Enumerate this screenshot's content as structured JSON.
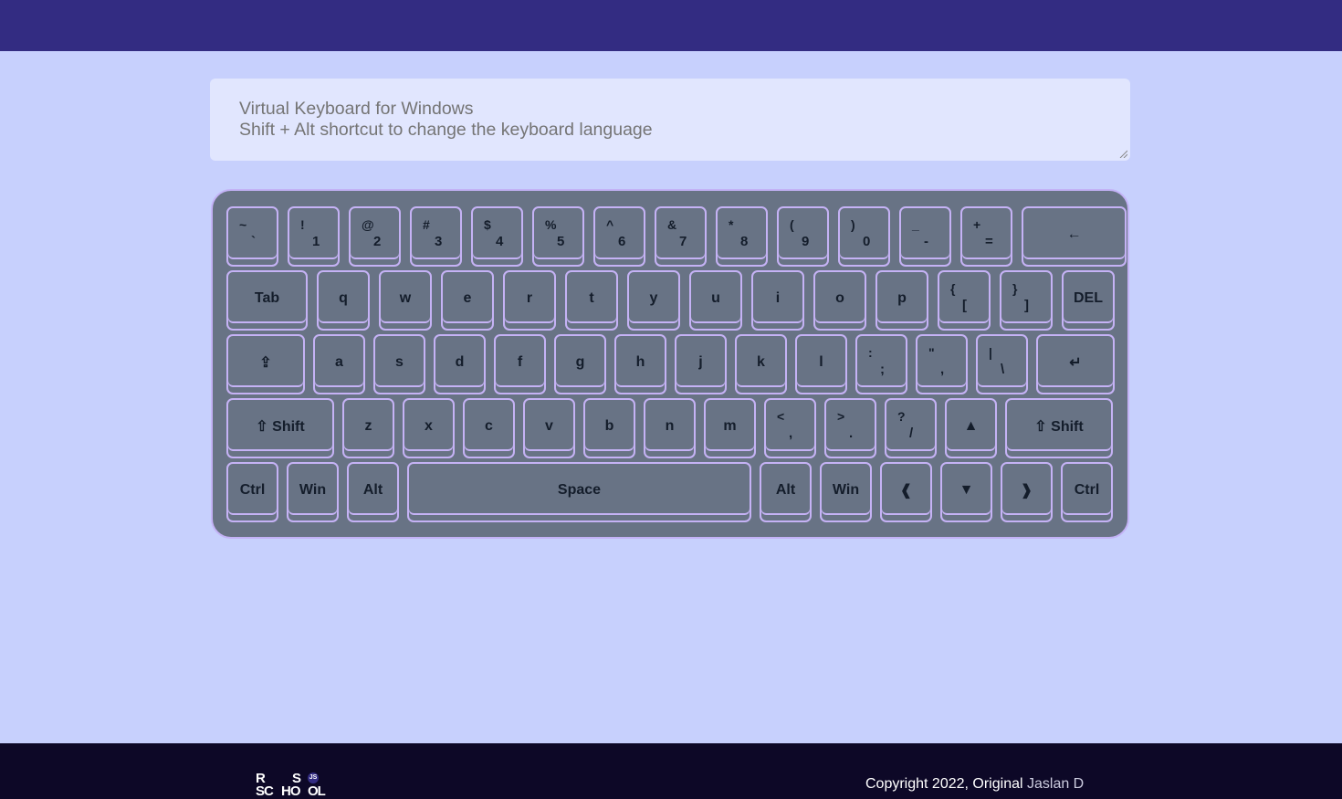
{
  "textarea": {
    "line1": "Virtual Keyboard for Windows",
    "line2": "Shift + Alt shortcut to change the keyboard language"
  },
  "keyboard": {
    "row1": [
      {
        "sym": "~",
        "main": "`"
      },
      {
        "sym": "!",
        "main": "1"
      },
      {
        "sym": "@",
        "main": "2"
      },
      {
        "sym": "#",
        "main": "3"
      },
      {
        "sym": "$",
        "main": "4"
      },
      {
        "sym": "%",
        "main": "5"
      },
      {
        "sym": "^",
        "main": "6"
      },
      {
        "sym": "&",
        "main": "7"
      },
      {
        "sym": "*",
        "main": "8"
      },
      {
        "sym": "(",
        "main": "9"
      },
      {
        "sym": ")",
        "main": "0"
      },
      {
        "sym": "_",
        "main": "-"
      },
      {
        "sym": "+",
        "main": "="
      },
      {
        "label": "←"
      }
    ],
    "row2": [
      {
        "label": "Tab"
      },
      {
        "label": "q"
      },
      {
        "label": "w"
      },
      {
        "label": "e"
      },
      {
        "label": "r"
      },
      {
        "label": "t"
      },
      {
        "label": "y"
      },
      {
        "label": "u"
      },
      {
        "label": "i"
      },
      {
        "label": "o"
      },
      {
        "label": "p"
      },
      {
        "sym": "{",
        "main": "["
      },
      {
        "sym": "}",
        "main": "]"
      },
      {
        "label": "DEL"
      }
    ],
    "row3": [
      {
        "label": "⇪"
      },
      {
        "label": "a"
      },
      {
        "label": "s"
      },
      {
        "label": "d"
      },
      {
        "label": "f"
      },
      {
        "label": "g"
      },
      {
        "label": "h"
      },
      {
        "label": "j"
      },
      {
        "label": "k"
      },
      {
        "label": "l"
      },
      {
        "sym": ":",
        "main": ";"
      },
      {
        "sym": "\"",
        "main": ","
      },
      {
        "sym": "|",
        "main": "\\"
      },
      {
        "label": "↵"
      }
    ],
    "row4": [
      {
        "label": "⇧ Shift"
      },
      {
        "label": "z"
      },
      {
        "label": "x"
      },
      {
        "label": "c"
      },
      {
        "label": "v"
      },
      {
        "label": "b"
      },
      {
        "label": "n"
      },
      {
        "label": "m"
      },
      {
        "sym": "<",
        "main": ","
      },
      {
        "sym": ">",
        "main": "."
      },
      {
        "sym": "?",
        "main": "/"
      },
      {
        "label": "▲"
      },
      {
        "label": "⇧ Shift"
      }
    ],
    "row5": [
      {
        "label": "Ctrl"
      },
      {
        "label": "Win"
      },
      {
        "label": "Alt"
      },
      {
        "label": "Space"
      },
      {
        "label": "Alt"
      },
      {
        "label": "Win"
      },
      {
        "label": "❰"
      },
      {
        "label": "▼"
      },
      {
        "label": "❱"
      },
      {
        "label": "Ctrl"
      }
    ]
  },
  "footer": {
    "logo": {
      "r": "R",
      "s": "S",
      "sc": "SC",
      "ho": "HO",
      "ol": "OL",
      "js": "JS"
    },
    "copyright_prefix": "Copyright 2022, Original ",
    "author": "Jaslan D"
  },
  "colors": {
    "header": "#332c82",
    "background": "#c7d0fd",
    "textarea": "#e1e6fe",
    "keyboard": "#687385",
    "key_border": "#c5b2f5",
    "footer": "#0d0827"
  }
}
